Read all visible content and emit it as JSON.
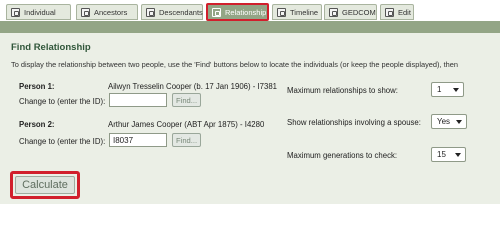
{
  "tabs": [
    {
      "label": "Individual",
      "icon": "person-card-icon",
      "active": false
    },
    {
      "label": "Ancestors",
      "icon": "ancestors-icon",
      "active": false
    },
    {
      "label": "Descendants",
      "icon": "descendants-icon",
      "active": false
    },
    {
      "label": "Relationship",
      "icon": "relationship-icon",
      "active": true
    },
    {
      "label": "Timeline",
      "icon": "timeline-icon",
      "active": false
    },
    {
      "label": "GEDCOM",
      "icon": "gedcom-icon",
      "active": false
    },
    {
      "label": "Edit",
      "icon": "edit-icon",
      "active": false
    }
  ],
  "section": {
    "title": "Find Relationship",
    "intro": "To display the relationship between two people, use the 'Find' buttons below to locate the individuals (or keep the people displayed), then"
  },
  "person1": {
    "label": "Person 1:",
    "value": "Ailwyn Tresselin Cooper (b. 17 Jan 1906) - I7381",
    "change_label": "Change to (enter the ID):",
    "id_value": "",
    "find_label": "Find..."
  },
  "person2": {
    "label": "Person 2:",
    "value": "Arthur James Cooper (ABT Apr 1875) - I4280",
    "change_label": "Change to (enter the ID):",
    "id_value": "I8037",
    "find_label": "Find..."
  },
  "options": {
    "max_relationships": {
      "label": "Maximum relationships to show:",
      "value": "1"
    },
    "involving_spouse": {
      "label": "Show relationships involving a spouse:",
      "value": "Yes"
    },
    "max_generations": {
      "label": "Maximum generations to check:",
      "value": "15"
    }
  },
  "calculate_label": "Calculate",
  "colors": {
    "tab_active": "#93a586",
    "panel_bg": "#ebefe6",
    "heading": "#30563a",
    "highlight": "#d11f2c"
  }
}
